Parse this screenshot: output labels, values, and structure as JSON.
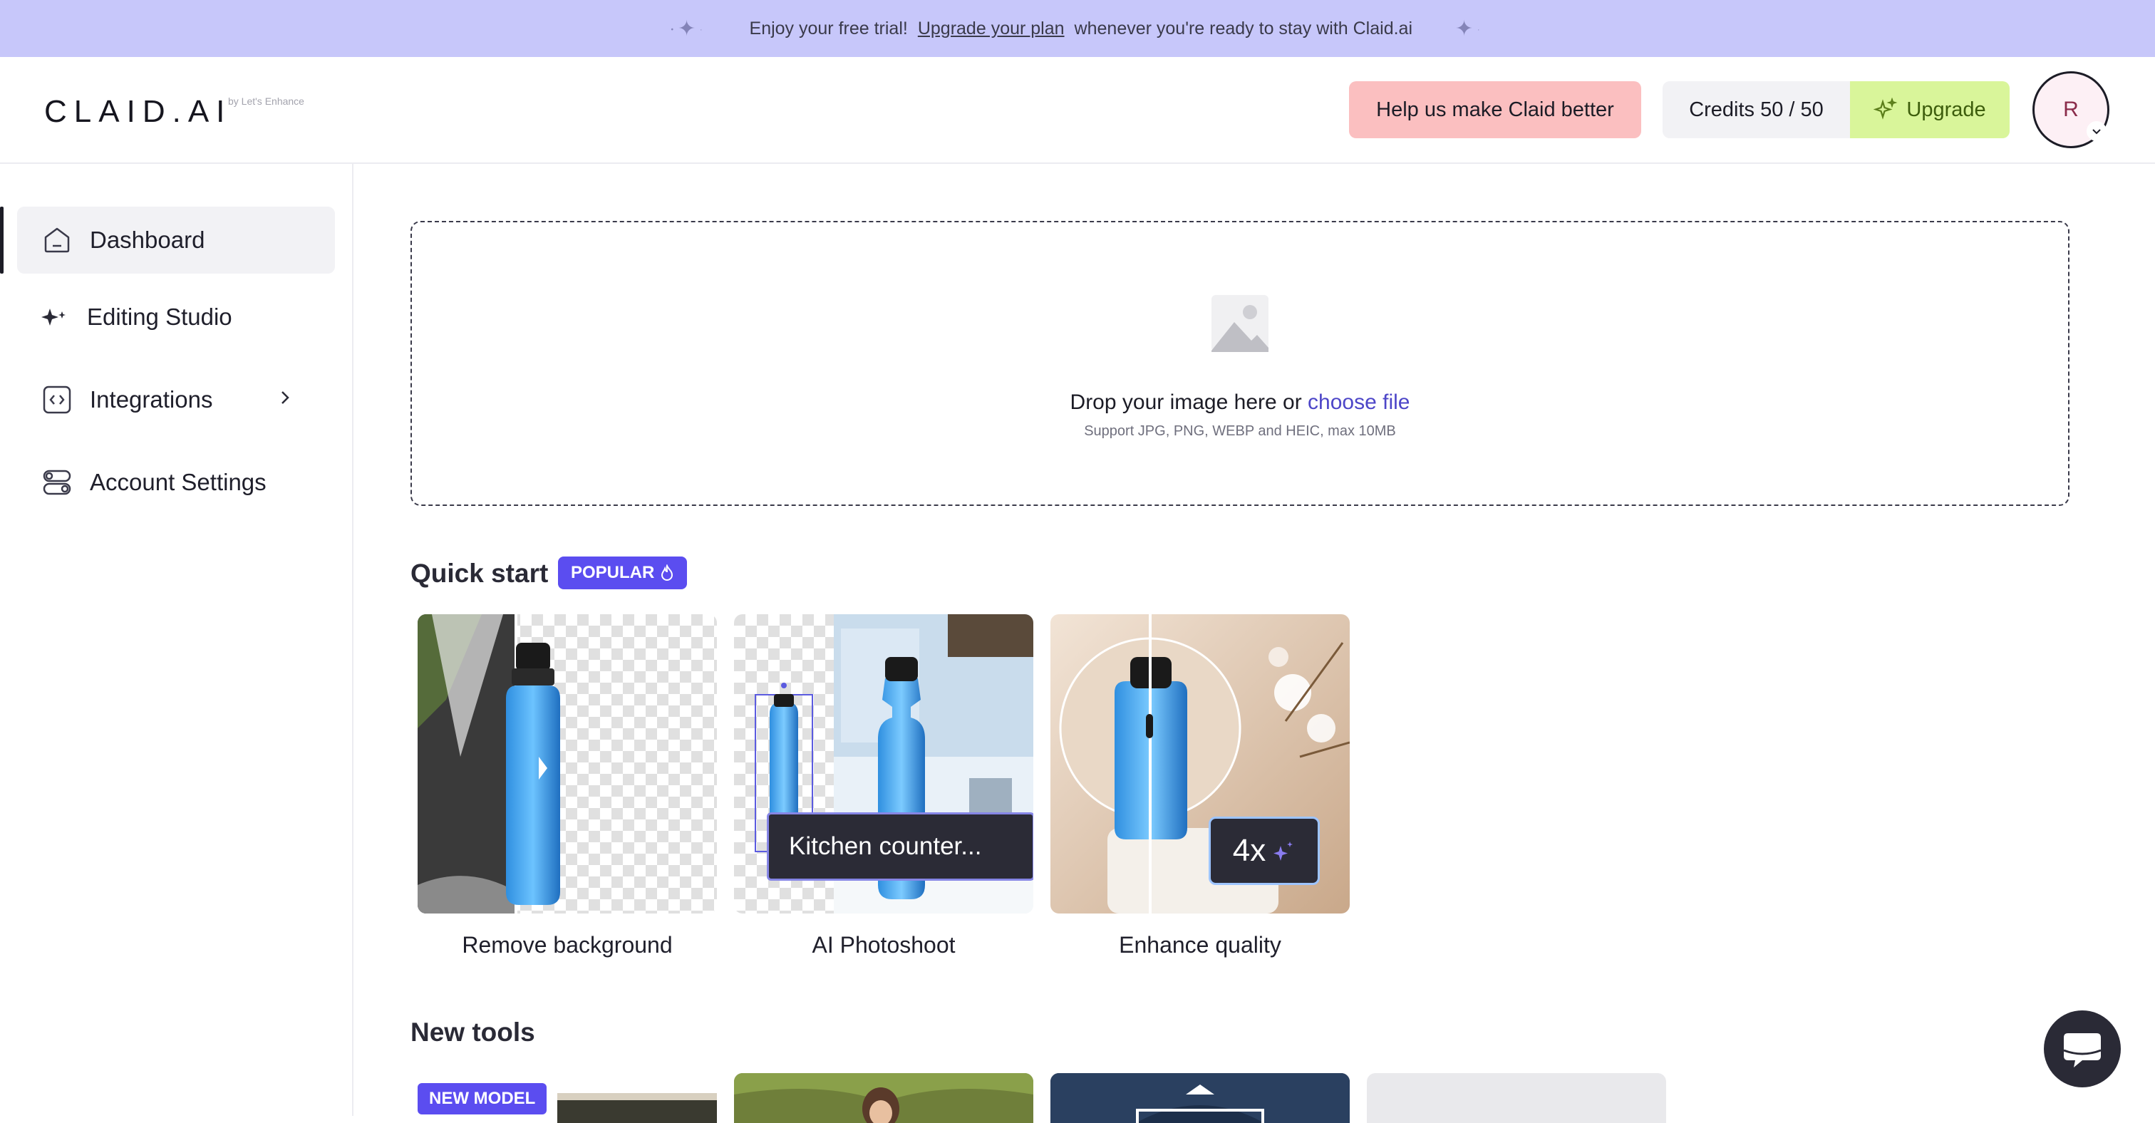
{
  "banner": {
    "text_before": "Enjoy your free trial!",
    "link_text": "Upgrade your plan",
    "text_after": "whenever you're ready to stay with Claid.ai"
  },
  "header": {
    "logo": "CLAID.AI",
    "logo_sub": "by Let's Enhance",
    "feedback_label": "Help us make Claid better",
    "credits_label": "Credits 50 / 50",
    "upgrade_label": "Upgrade",
    "avatar_initial": "R"
  },
  "sidebar": {
    "items": [
      {
        "label": "Dashboard",
        "icon": "home-icon"
      },
      {
        "label": "Editing Studio",
        "icon": "sparkle-icon"
      },
      {
        "label": "Integrations",
        "icon": "code-icon"
      },
      {
        "label": "Account Settings",
        "icon": "toggles-icon"
      }
    ]
  },
  "dropzone": {
    "prompt": "Drop your image here or",
    "choose_file": "choose file",
    "support": "Support JPG, PNG, WEBP and HEIC, max 10MB"
  },
  "quick_start": {
    "title": "Quick start",
    "badge": "POPULAR",
    "cards": [
      {
        "label": "Remove background"
      },
      {
        "label": "AI Photoshoot",
        "overlay": "Kitchen counter..."
      },
      {
        "label": "Enhance quality",
        "overlay": "4x"
      }
    ]
  },
  "new_tools": {
    "title": "New tools",
    "badge": "NEW MODEL"
  },
  "colors": {
    "banner": "#c7c7fa",
    "accent": "#5b4df0",
    "link": "#4d46c8",
    "feedback": "#fbbfc0",
    "upgrade": "#d9f59a"
  }
}
